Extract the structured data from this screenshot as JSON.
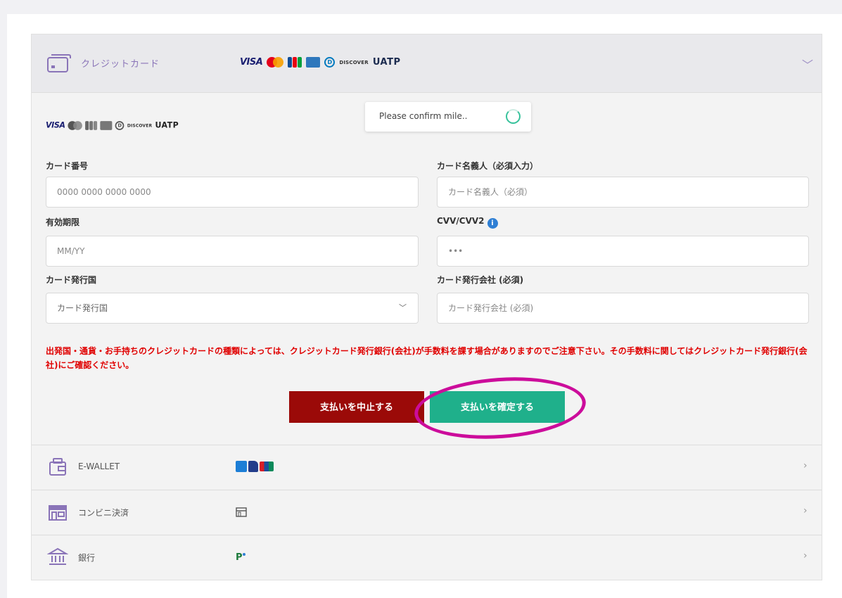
{
  "credit_card": {
    "title": "クレジットカード",
    "brands": [
      "VISA",
      "Mastercard",
      "JCB",
      "American Express",
      "Diners Club",
      "DISCOVER",
      "UATP"
    ],
    "visa_text": "VISA",
    "discover_text": "DISCOVER",
    "uatp_text": "UATP",
    "diners_text": "D"
  },
  "toast": {
    "text": "Please confirm mile.."
  },
  "form": {
    "card_number_label": "カード番号",
    "card_number_placeholder": "0000 0000 0000 0000",
    "holder_label": "カード名義人（必須入力）",
    "holder_placeholder": "カード名義人（必須）",
    "expiry_label": "有効期限",
    "expiry_placeholder": "MM/YY",
    "cvv_label": "CVV/CVV2",
    "cvv_placeholder": "•••",
    "country_label": "カード発行国",
    "country_selected": "カード発行国",
    "issuer_label": "カード発行会社 (必須)",
    "issuer_placeholder": "カード発行会社 (必須)"
  },
  "notice": "出発国・通貨・お手持ちのクレジットカードの種類によっては、クレジットカード発行銀行(会社)が手数料を課す場合がありますのでご注意下さい。その手数料に関してはクレジットカード発行銀行(会社)にご確認ください。",
  "buttons": {
    "cancel": "支払いを中止する",
    "confirm": "支払いを確定する"
  },
  "methods": [
    {
      "label": "E-WALLET"
    },
    {
      "label": "コンビニ決済"
    },
    {
      "label": "銀行"
    }
  ],
  "colors": {
    "accent_purple": "#8a74b8",
    "cancel_red": "#9b0a08",
    "confirm_green": "#1fb08b",
    "notice_red": "#e00000",
    "highlight_magenta": "#cc0c9b"
  }
}
